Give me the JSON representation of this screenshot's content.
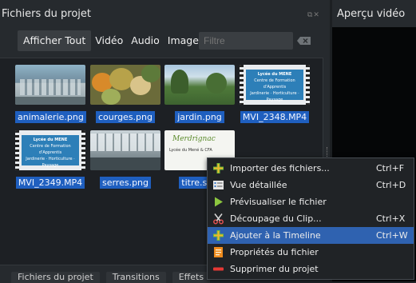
{
  "panel": {
    "title": "Fichiers du projet"
  },
  "preview": {
    "title": "Aperçu vidéo"
  },
  "filters": {
    "show_all": "Afficher Tout",
    "video": "Vidéo",
    "audio": "Audio",
    "image": "Image",
    "placeholder": "Filtre"
  },
  "files": [
    {
      "name": "animalerie.png"
    },
    {
      "name": "courges.png"
    },
    {
      "name": "jardin.png"
    },
    {
      "name": "MVI_2348.MP4"
    },
    {
      "name": "MVI_2349.MP4"
    },
    {
      "name": "serres.png"
    },
    {
      "name": "titre.svg"
    }
  ],
  "thumb_text": {
    "lycee_title": "Lycée du MENE",
    "lycee_line1": "Centre de Formation d'Apprentis",
    "lycee_line2": "Jardinerie · Horticulture · Paysage",
    "brand": "Merdrignac",
    "brand_sub": "Lycée du Mené & CFA"
  },
  "bottom_tabs": [
    "Fichiers du projet",
    "Transitions",
    "Effets"
  ],
  "context_menu": {
    "items": [
      {
        "label": "Importer des fichiers...",
        "shortcut": "Ctrl+F",
        "icon": "plus-icon"
      },
      {
        "label": "Vue détaillée",
        "shortcut": "Ctrl+D",
        "icon": "detail-view-icon"
      },
      {
        "label": "Prévisualiser le fichier",
        "shortcut": "",
        "icon": "play-icon"
      },
      {
        "label": "Découpage du Clip...",
        "shortcut": "Ctrl+X",
        "icon": "scissors-icon"
      },
      {
        "label": "Ajouter à la Timeline",
        "shortcut": "Ctrl+W",
        "icon": "plus-icon"
      },
      {
        "label": "Propriétés du fichier",
        "shortcut": "",
        "icon": "properties-icon"
      },
      {
        "label": "Supprimer du projet",
        "shortcut": "",
        "icon": "minus-icon"
      }
    ],
    "active_index": 4
  },
  "colors": {
    "background": "#262a2e",
    "selection": "#1f5fbf",
    "menu_highlight": "#2f62b0"
  }
}
